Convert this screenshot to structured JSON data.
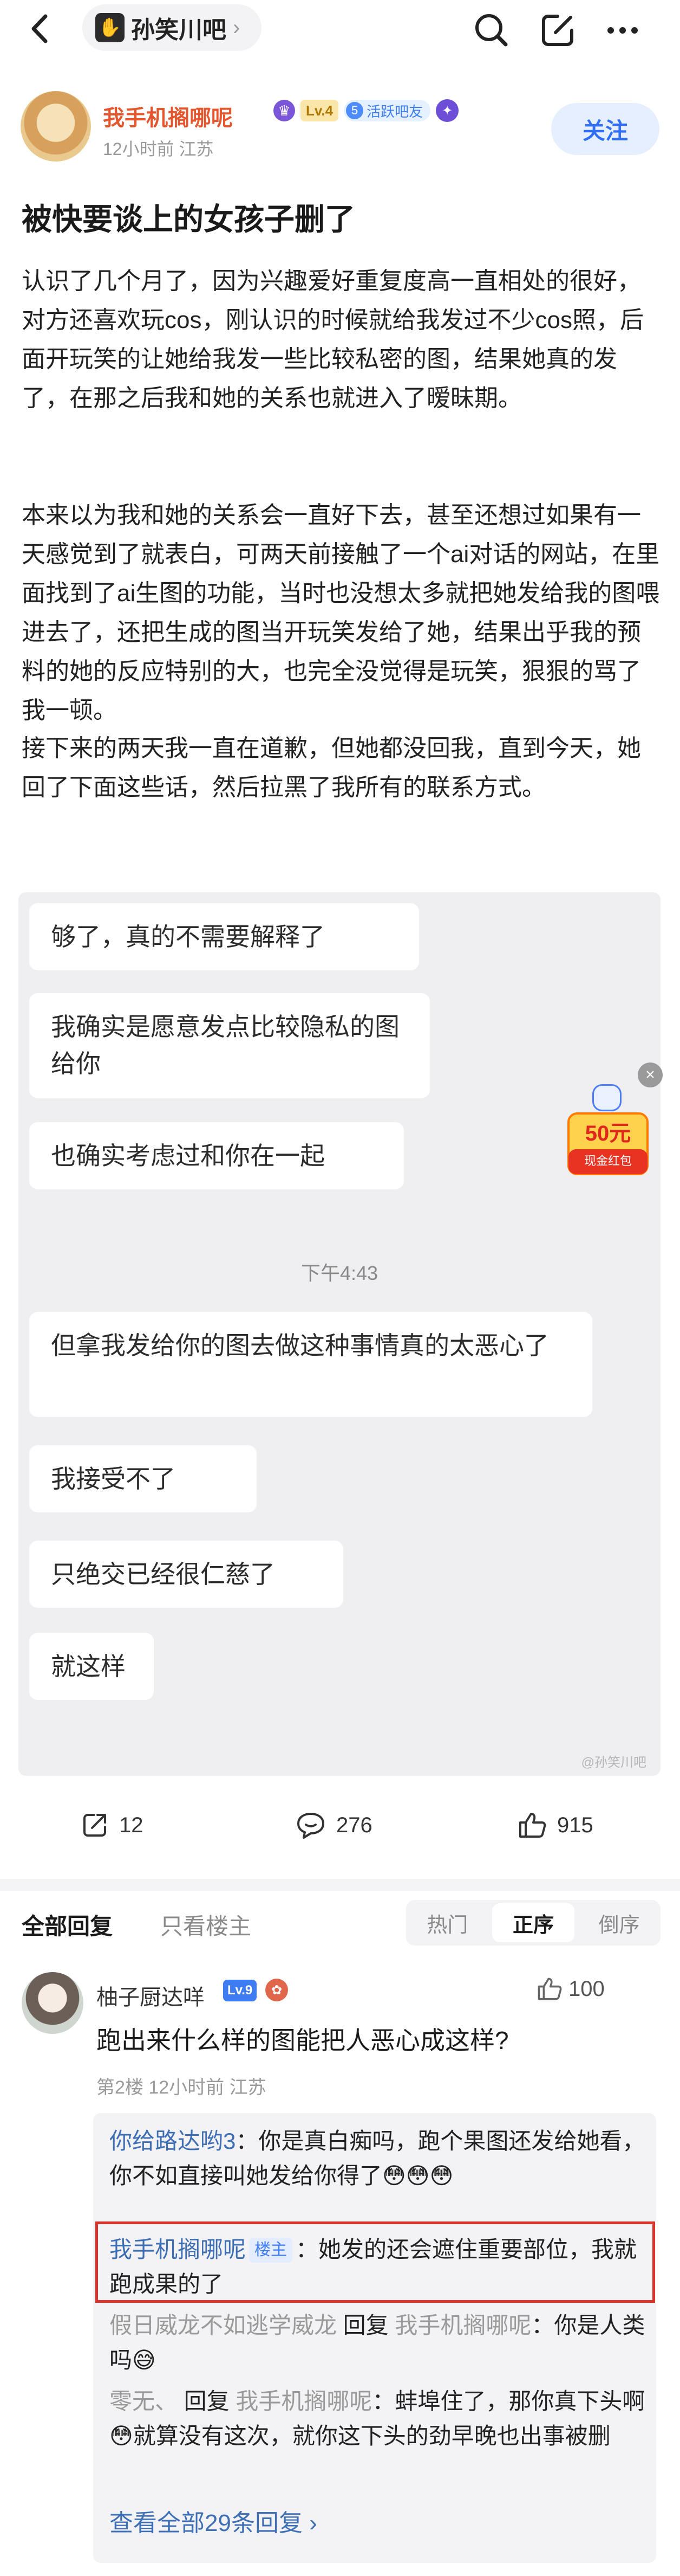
{
  "nav": {
    "forum_name": "孙笑川吧",
    "forum_arrow": "›"
  },
  "author": {
    "name": "我手机搁哪呢",
    "level_badge": "Lv.4",
    "active_badge_num": "5",
    "active_badge_text": "活跃吧友",
    "meta": "12小时前   江苏",
    "follow_label": "关注"
  },
  "post": {
    "title": "被快要谈上的女孩子删了",
    "paragraphs": [
      "认识了几个月了，因为兴趣爱好重复度高一直相处的很好，对方还喜欢玩cos，刚认识的时候就给我发过不少cos照，后面开玩笑的让她给我发一些比较私密的图，结果她真的发了，在那之后我和她的关系也就进入了暧昧期。",
      "本来以为我和她的关系会一直好下去，甚至还想过如果有一天感觉到了就表白，可两天前接触了一个ai对话的网站，在里面找到了ai生图的功能，当时也没想太多就把她发给我的图喂进去了，还把生成的图当开玩笑发给了她，结果出乎我的预料的她的反应特别的大，也完全没觉得是玩笑，狠狠的骂了我一顿。",
      "接下来的两天我一直在道歉，但她都没回我，直到今天，她回了下面这些话，然后拉黑了我所有的联系方式。"
    ]
  },
  "chat": {
    "messages": [
      "够了，真的不需要解释了",
      "我确实是愿意发点比较隐私的图给你",
      "也确实考虑过和你在一起",
      "但拿我发给你的图去做这种事情真的太恶心了",
      "我接受不了",
      "只绝交已经很仁慈了",
      "就这样"
    ],
    "time": "下午4:43",
    "watermark": "@孙笑川吧"
  },
  "ad": {
    "close": "×",
    "amount": "50元",
    "label": "现金红包"
  },
  "actions": {
    "share_count": "12",
    "comment_count": "276",
    "like_count": "915"
  },
  "comments_header": {
    "tab_all": "全部回复",
    "tab_op_only": "只看楼主",
    "sort_hot": "热门",
    "sort_order": "正序",
    "sort_reverse": "倒序"
  },
  "comment": {
    "name": "柚子厨达咩",
    "level": "Lv.9",
    "likes": "100",
    "text": "跑出来什么样的图能把人恶心成这样?",
    "meta": "第2楼  12小时前  江苏",
    "replies": [
      {
        "user": "你给路达哟3",
        "text": "：你是真白痴吗，跑个果图还发给她看，你不如直接叫她发给你得了😳😳😳"
      },
      {
        "user": "我手机搁哪呢",
        "op_badge": "楼主",
        "text": "：她发的还会遮住重要部位，我就跑成果的了"
      },
      {
        "user": "假日威龙不如逃学威龙",
        "reply_word": " 回复 ",
        "target": "我手机搁哪呢",
        "text": "：你是人类吗😅"
      },
      {
        "user": "零无、",
        "reply_word": " 回复 ",
        "target": "我手机搁哪呢",
        "text": "：蚌埠住了，那你真下头啊😳就算没有这次，就你这下头的劲早晚也出事被删"
      }
    ],
    "view_all": "查看全部29条回复 ›"
  }
}
